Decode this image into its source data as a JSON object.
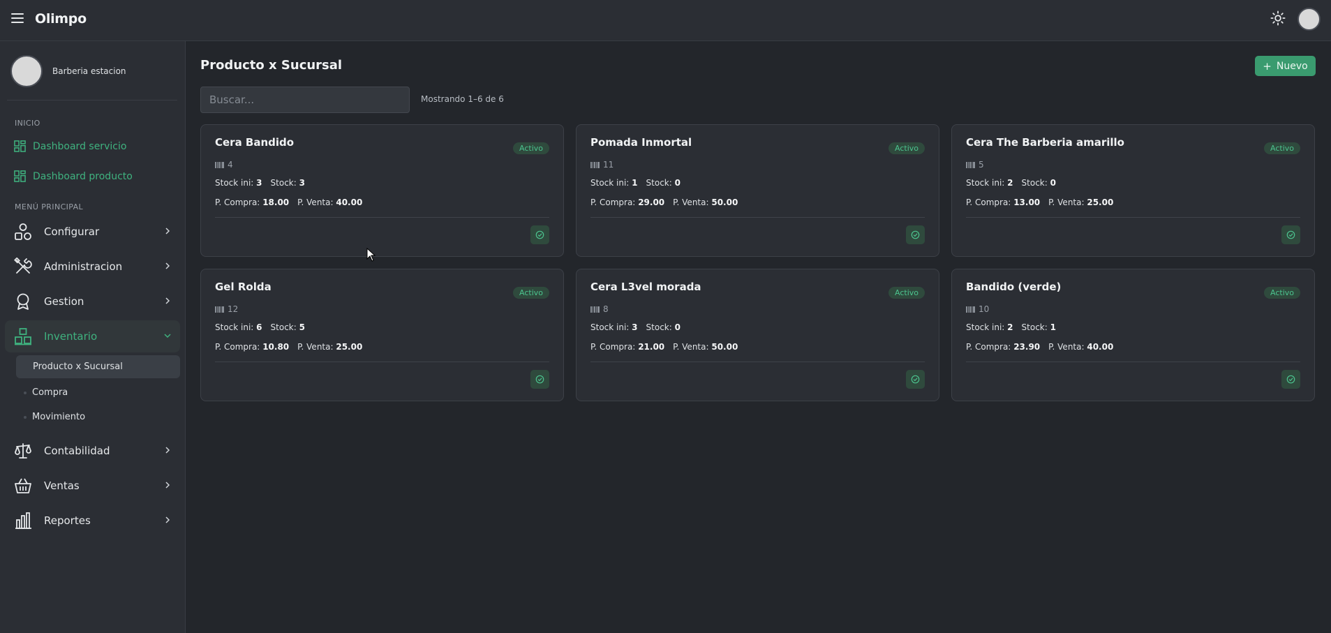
{
  "app": {
    "title": "Olimpo"
  },
  "user": {
    "name": "Barberia estacion"
  },
  "sidebar": {
    "section_inicio": "INICIO",
    "dashboards": [
      {
        "label": "Dashboard servicio"
      },
      {
        "label": "Dashboard producto"
      }
    ],
    "section_menu": "MENÚ PRINCIPAL",
    "items": [
      {
        "label": "Configurar"
      },
      {
        "label": "Administracion"
      },
      {
        "label": "Gestion"
      },
      {
        "label": "Inventario"
      },
      {
        "label": "Contabilidad"
      },
      {
        "label": "Ventas"
      },
      {
        "label": "Reportes"
      }
    ],
    "inventario_sub": [
      {
        "label": "Producto x Sucursal"
      },
      {
        "label": "Compra"
      },
      {
        "label": "Movimiento"
      }
    ]
  },
  "main": {
    "title": "Producto x Sucursal",
    "new_button": "Nuevo",
    "search_placeholder": "Buscar...",
    "count_text": "Mostrando 1–6 de 6",
    "labels": {
      "stock_ini": "Stock ini:",
      "stock": "Stock:",
      "p_compra": "P. Compra:",
      "p_venta": "P. Venta:"
    },
    "cards": [
      {
        "name": "Cera Bandido",
        "status": "Activo",
        "code": "4",
        "stock_ini": "3",
        "stock": "3",
        "p_compra": "18.00",
        "p_venta": "40.00"
      },
      {
        "name": "Pomada Inmortal",
        "status": "Activo",
        "code": "11",
        "stock_ini": "1",
        "stock": "0",
        "p_compra": "29.00",
        "p_venta": "50.00"
      },
      {
        "name": "Cera The Barberia amarillo",
        "status": "Activo",
        "code": "5",
        "stock_ini": "2",
        "stock": "0",
        "p_compra": "13.00",
        "p_venta": "25.00"
      },
      {
        "name": "Gel Rolda",
        "status": "Activo",
        "code": "12",
        "stock_ini": "6",
        "stock": "5",
        "p_compra": "10.80",
        "p_venta": "25.00"
      },
      {
        "name": "Cera L3vel morada",
        "status": "Activo",
        "code": "8",
        "stock_ini": "3",
        "stock": "0",
        "p_compra": "21.00",
        "p_venta": "50.00"
      },
      {
        "name": "Bandido (verde)",
        "status": "Activo",
        "code": "10",
        "stock_ini": "2",
        "stock": "1",
        "p_compra": "23.90",
        "p_venta": "40.00"
      }
    ]
  },
  "colors": {
    "accent": "#3fb27f",
    "button": "#3a9b6f",
    "background": "#23262b",
    "panel": "#2b2e34"
  },
  "icons": {
    "menu": "hamburger-icon",
    "theme": "sun-icon",
    "dashboard": "grid-icon",
    "configurar": "shapes-icon",
    "administracion": "tools-icon",
    "gestion": "award-icon",
    "inventario": "boxes-icon",
    "contabilidad": "scale-icon",
    "ventas": "basket-icon",
    "reportes": "bar-chart-icon",
    "code": "barcode-icon",
    "action": "check-circle-icon"
  }
}
